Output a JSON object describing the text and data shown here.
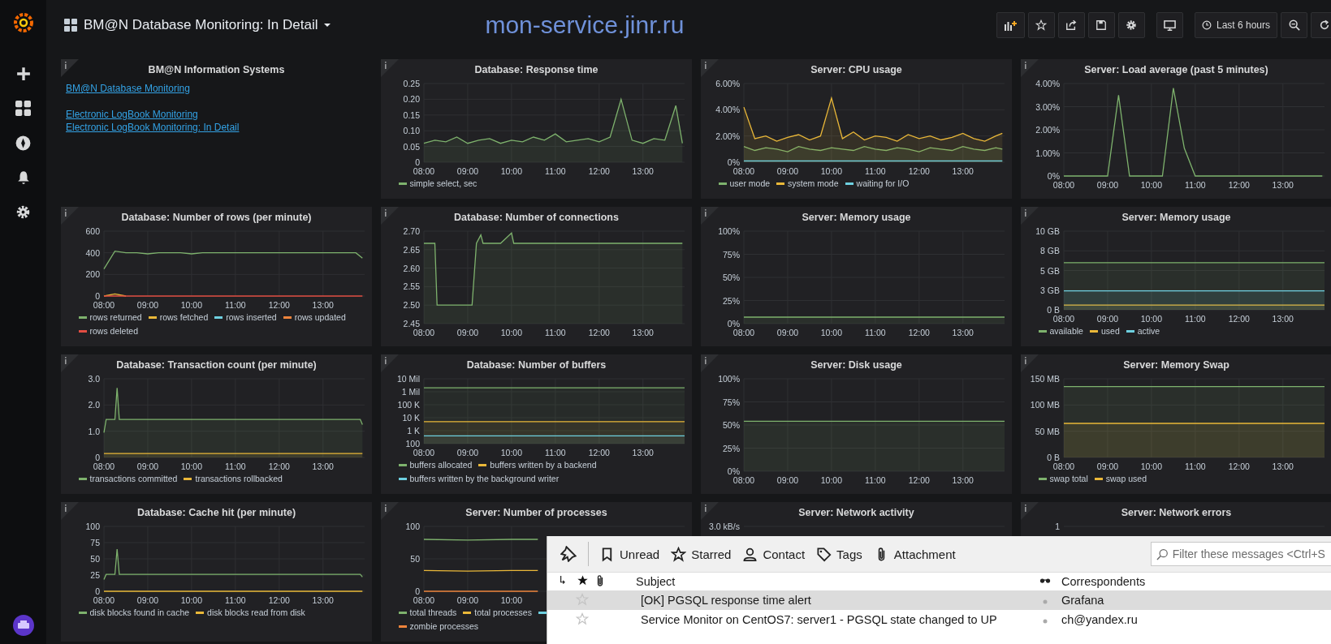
{
  "topbar": {
    "title": "BM@N Database Monitoring: In Detail",
    "site_text": "mon-service.jinr.ru",
    "time_range": "Last 6 hours"
  },
  "panels": [
    {
      "kind": "text",
      "title": "BM@N Information Systems",
      "link_groups": [
        [
          "BM@N Database Monitoring"
        ],
        [
          "Electronic LogBook Monitoring",
          "Electronic LogBook Monitoring: In Detail"
        ]
      ]
    },
    {
      "kind": "graph",
      "title": "Database: Response time",
      "chart_data": {
        "type": "area",
        "grid": true,
        "xlim": [
          8,
          13.95
        ],
        "ylim": [
          0,
          0.25
        ],
        "xticks": [
          {
            "value": 8,
            "label": "08:00"
          },
          {
            "value": 9,
            "label": "09:00"
          },
          {
            "value": 10,
            "label": "10:00"
          },
          {
            "value": 11,
            "label": "11:00"
          },
          {
            "value": 12,
            "label": "12:00"
          },
          {
            "value": 13,
            "label": "13:00"
          }
        ],
        "yticks": [
          {
            "value": 0,
            "label": "0"
          },
          {
            "value": 0.05,
            "label": "0.05"
          },
          {
            "value": 0.1,
            "label": "0.10"
          },
          {
            "value": 0.15,
            "label": "0.15"
          },
          {
            "value": 0.2,
            "label": "0.20"
          },
          {
            "value": 0.25,
            "label": "0.25"
          }
        ],
        "x": [
          8,
          8.25,
          8.5,
          8.75,
          9,
          9.25,
          9.5,
          9.75,
          10,
          10.25,
          10.5,
          10.75,
          11,
          11.25,
          11.5,
          11.75,
          12,
          12.25,
          12.5,
          12.75,
          13,
          13.25,
          13.5,
          13.75,
          13.9
        ],
        "series": [
          {
            "name": "simple select, sec",
            "color": "#7eb26d",
            "values": [
              0.06,
              0.07,
              0.065,
              0.08,
              0.06,
              0.07,
              0.075,
              0.06,
              0.07,
              0.065,
              0.08,
              0.07,
              0.09,
              0.065,
              0.07,
              0.075,
              0.065,
              0.08,
              0.2,
              0.07,
              0.06,
              0.075,
              0.07,
              0.18,
              0.06
            ]
          }
        ]
      }
    },
    {
      "kind": "graph",
      "title": "Server: CPU usage",
      "chart_data": {
        "type": "area",
        "grid": true,
        "xlim": [
          8,
          13.95
        ],
        "ylim": [
          0,
          6
        ],
        "xticks": [
          {
            "value": 8,
            "label": "08:00"
          },
          {
            "value": 9,
            "label": "09:00"
          },
          {
            "value": 10,
            "label": "10:00"
          },
          {
            "value": 11,
            "label": "11:00"
          },
          {
            "value": 12,
            "label": "12:00"
          },
          {
            "value": 13,
            "label": "13:00"
          }
        ],
        "yticks": [
          {
            "value": 0,
            "label": "0%"
          },
          {
            "value": 2,
            "label": "2.00%"
          },
          {
            "value": 4,
            "label": "4.00%"
          },
          {
            "value": 6,
            "label": "6.00%"
          }
        ],
        "x": [
          8,
          8.25,
          8.5,
          8.75,
          9,
          9.25,
          9.5,
          9.75,
          10,
          10.25,
          10.5,
          10.75,
          11,
          11.25,
          11.5,
          11.75,
          12,
          12.25,
          12.5,
          12.75,
          13,
          13.25,
          13.5,
          13.75,
          13.9
        ],
        "series": [
          {
            "name": "user mode",
            "color": "#7eb26d",
            "values": [
              1.2,
              0.9,
              1.1,
              1.0,
              0.8,
              1.2,
              1.0,
              0.9,
              1.1,
              1.0,
              0.9,
              1.2,
              1.0,
              0.9,
              1.1,
              1.0,
              0.8,
              1.1,
              1.0,
              0.9,
              1.2,
              1.0,
              0.9,
              1.1,
              1.0
            ]
          },
          {
            "name": "system mode",
            "color": "#eab839",
            "values": [
              4.2,
              1.8,
              2.0,
              1.6,
              1.9,
              2.1,
              1.7,
              2.0,
              4.9,
              1.8,
              2.3,
              1.7,
              2.0,
              1.9,
              1.6,
              2.1,
              1.8,
              2.0,
              1.7,
              1.9,
              2.2,
              1.8,
              1.6,
              2.0,
              2.2
            ]
          },
          {
            "name": "waiting for I/O",
            "color": "#6ed0e0",
            "values": [
              0.1,
              0.1,
              0.1,
              0.1,
              0.1,
              0.1,
              0.1,
              0.1,
              0.1,
              0.1,
              0.1,
              0.1,
              0.1,
              0.1,
              0.1,
              0.1,
              0.1,
              0.1,
              0.1,
              0.1,
              0.1,
              0.1,
              0.1,
              0.1,
              0.1
            ]
          }
        ]
      }
    },
    {
      "kind": "graph",
      "title": "Server: Load average (past 5 minutes)",
      "chart_data": {
        "type": "line",
        "grid": true,
        "xlim": [
          8,
          13.95
        ],
        "ylim": [
          0,
          4
        ],
        "xticks": [
          {
            "value": 8,
            "label": "08:00"
          },
          {
            "value": 9,
            "label": "09:00"
          },
          {
            "value": 10,
            "label": "10:00"
          },
          {
            "value": 11,
            "label": "11:00"
          },
          {
            "value": 12,
            "label": "12:00"
          },
          {
            "value": 13,
            "label": "13:00"
          }
        ],
        "yticks": [
          {
            "value": 0,
            "label": "0%"
          },
          {
            "value": 1,
            "label": "1.00%"
          },
          {
            "value": 2,
            "label": "2.00%"
          },
          {
            "value": 3,
            "label": "3.00%"
          },
          {
            "value": 4,
            "label": "4.00%"
          }
        ],
        "x": [
          8,
          8.25,
          8.5,
          8.75,
          9,
          9.25,
          9.5,
          9.75,
          10,
          10.25,
          10.5,
          10.75,
          11,
          11.25,
          11.5,
          11.75,
          12,
          12.25,
          12.5,
          12.75,
          13,
          13.25,
          13.5,
          13.75,
          13.9
        ],
        "series": [
          {
            "color": "#7eb26d",
            "values": [
              0,
              0,
              0,
              0,
              0,
              3.5,
              0,
              0,
              0,
              0,
              3.8,
              1.2,
              0,
              0,
              0,
              0,
              0,
              0,
              0,
              0,
              0,
              0,
              0,
              0,
              0
            ]
          }
        ]
      }
    },
    {
      "kind": "graph",
      "title": "Database: Number of rows (per minute)",
      "chart_data": {
        "type": "line",
        "grid": true,
        "xlim": [
          8,
          13.95
        ],
        "ylim": [
          0,
          600
        ],
        "xticks": [
          {
            "value": 8,
            "label": "08:00"
          },
          {
            "value": 9,
            "label": "09:00"
          },
          {
            "value": 10,
            "label": "10:00"
          },
          {
            "value": 11,
            "label": "11:00"
          },
          {
            "value": 12,
            "label": "12:00"
          },
          {
            "value": 13,
            "label": "13:00"
          }
        ],
        "yticks": [
          0,
          200,
          400,
          600
        ],
        "x": [
          8,
          8.25,
          8.5,
          8.75,
          9,
          9.25,
          9.5,
          9.75,
          10,
          10.25,
          10.5,
          10.75,
          11,
          11.25,
          11.5,
          11.75,
          12,
          12.25,
          12.5,
          12.75,
          13,
          13.25,
          13.5,
          13.75,
          13.9
        ],
        "series": [
          {
            "name": "rows returned",
            "color": "#7eb26d",
            "values": [
              250,
              415,
              400,
              400,
              390,
              400,
              400,
              400,
              390,
              400,
              400,
              400,
              400,
              400,
              400,
              400,
              400,
              400,
              400,
              400,
              400,
              400,
              400,
              400,
              350
            ]
          },
          {
            "name": "rows fetched",
            "color": "#eab839",
            "values": [
              0,
              20,
              0,
              null,
              null,
              null,
              null,
              null,
              null,
              null,
              null,
              null,
              null,
              null,
              null,
              null,
              null,
              null,
              null,
              null,
              null,
              null,
              null,
              null,
              null
            ]
          },
          {
            "name": "rows inserted",
            "color": "#6ed0e0",
            "values": [
              null,
              null,
              null,
              null,
              null,
              null,
              null,
              null,
              null,
              null,
              null,
              null,
              null,
              null,
              null,
              null,
              null,
              null,
              null,
              null,
              null,
              null,
              null,
              null,
              null
            ]
          },
          {
            "name": "rows updated",
            "color": "#ef843c",
            "values": [
              null,
              null,
              null,
              null,
              null,
              null,
              null,
              null,
              null,
              null,
              null,
              null,
              null,
              null,
              null,
              null,
              null,
              null,
              null,
              null,
              null,
              null,
              null,
              null,
              null
            ]
          },
          {
            "name": "rows deleted",
            "color": "#e24d42",
            "values": [
              0,
              0,
              0,
              0,
              0,
              0,
              0,
              0,
              0,
              0,
              0,
              0,
              0,
              0,
              0,
              0,
              0,
              0,
              0,
              0,
              0,
              0,
              0,
              0,
              0
            ]
          }
        ]
      }
    },
    {
      "kind": "graph",
      "title": "Database: Number of connections",
      "chart_data": {
        "type": "area",
        "grid": true,
        "xlim": [
          8,
          13.95
        ],
        "ylim": [
          2.45,
          2.7
        ],
        "xticks": [
          {
            "value": 8,
            "label": "08:00"
          },
          {
            "value": 9,
            "label": "09:00"
          },
          {
            "value": 10,
            "label": "10:00"
          },
          {
            "value": 11,
            "label": "11:00"
          },
          {
            "value": 12,
            "label": "12:00"
          },
          {
            "value": 13,
            "label": "13:00"
          }
        ],
        "yticks": [
          {
            "value": 2.45,
            "label": "2.45"
          },
          {
            "value": 2.5,
            "label": "2.50"
          },
          {
            "value": 2.55,
            "label": "2.55"
          },
          {
            "value": 2.6,
            "label": "2.60"
          },
          {
            "value": 2.65,
            "label": "2.65"
          },
          {
            "value": 2.7,
            "label": "2.70"
          }
        ],
        "x": [
          8,
          8.25,
          8.3,
          8.75,
          9,
          9.1,
          9.2,
          9.3,
          9.35,
          9.75,
          10,
          10.05,
          10.5,
          11,
          11.5,
          12,
          12.5,
          13,
          13.5,
          13.9
        ],
        "series": [
          {
            "color": "#7eb26d",
            "values": [
              2.667,
              2.667,
              2.5,
              2.5,
              2.5,
              2.5,
              2.667,
              2.69,
              2.667,
              2.667,
              2.695,
              2.667,
              2.667,
              2.667,
              2.667,
              2.667,
              2.667,
              2.667,
              2.667,
              2.667
            ]
          }
        ]
      }
    },
    {
      "kind": "graph",
      "title": "Server: Memory usage",
      "chart_data": {
        "type": "area",
        "grid": true,
        "xlim": [
          8,
          13.95
        ],
        "ylim": [
          0,
          100
        ],
        "xticks": [
          {
            "value": 8,
            "label": "08:00"
          },
          {
            "value": 9,
            "label": "09:00"
          },
          {
            "value": 10,
            "label": "10:00"
          },
          {
            "value": 11,
            "label": "11:00"
          },
          {
            "value": 12,
            "label": "12:00"
          },
          {
            "value": 13,
            "label": "13:00"
          }
        ],
        "yticks": [
          {
            "value": 0,
            "label": "0%"
          },
          {
            "value": 25,
            "label": "25%"
          },
          {
            "value": 50,
            "label": "50%"
          },
          {
            "value": 75,
            "label": "75%"
          },
          {
            "value": 100,
            "label": "100%"
          }
        ],
        "x": [
          8,
          13.95
        ],
        "series": [
          {
            "color": "#7eb26d",
            "values": [
              7,
              7
            ]
          }
        ]
      }
    },
    {
      "kind": "graph",
      "title": "Server: Memory usage",
      "chart_data": {
        "type": "area",
        "grid": true,
        "xlim": [
          8,
          13.95
        ],
        "ylim": [
          0,
          10
        ],
        "xticks": [
          {
            "value": 8,
            "label": "08:00"
          },
          {
            "value": 9,
            "label": "09:00"
          },
          {
            "value": 10,
            "label": "10:00"
          },
          {
            "value": 11,
            "label": "11:00"
          },
          {
            "value": 12,
            "label": "12:00"
          },
          {
            "value": 13,
            "label": "13:00"
          }
        ],
        "yticks": [
          {
            "value": 0,
            "label": "0 B"
          },
          {
            "value": 2.5,
            "label": "3 GB"
          },
          {
            "value": 5,
            "label": "5 GB"
          },
          {
            "value": 7.5,
            "label": "8 GB"
          },
          {
            "value": 10,
            "label": "10 GB"
          }
        ],
        "x": [
          8,
          13.95
        ],
        "series": [
          {
            "name": "available",
            "color": "#7eb26d",
            "values": [
              6.0,
              6.0
            ]
          },
          {
            "name": "used",
            "color": "#eab839",
            "values": [
              0.6,
              0.6
            ]
          },
          {
            "name": "active",
            "color": "#6ed0e0",
            "values": [
              2.4,
              2.4
            ]
          }
        ]
      }
    },
    {
      "kind": "graph",
      "title": "Database: Transaction count (per minute)",
      "chart_data": {
        "type": "area",
        "grid": true,
        "xlim": [
          8,
          13.95
        ],
        "ylim": [
          0,
          3
        ],
        "xticks": [
          {
            "value": 8,
            "label": "08:00"
          },
          {
            "value": 9,
            "label": "09:00"
          },
          {
            "value": 10,
            "label": "10:00"
          },
          {
            "value": 11,
            "label": "11:00"
          },
          {
            "value": 12,
            "label": "12:00"
          },
          {
            "value": 13,
            "label": "13:00"
          }
        ],
        "yticks": [
          {
            "value": 0,
            "label": "0"
          },
          {
            "value": 1,
            "label": "1.0"
          },
          {
            "value": 2,
            "label": "2.0"
          },
          {
            "value": 3,
            "label": "3.0"
          }
        ],
        "x": [
          8,
          8.05,
          8.25,
          8.3,
          8.35,
          8.5,
          9,
          9.5,
          10,
          10.5,
          11,
          11.5,
          12,
          12.5,
          13,
          13.5,
          13.85,
          13.9
        ],
        "series": [
          {
            "name": "transactions committed",
            "color": "#7eb26d",
            "values": [
              0.95,
              1.45,
              1.45,
              2.65,
              1.45,
              1.45,
              1.45,
              1.45,
              1.45,
              1.45,
              1.45,
              1.45,
              1.45,
              1.45,
              1.45,
              1.45,
              1.45,
              1.25
            ]
          },
          {
            "name": "transactions rollbacked",
            "color": "#eab839",
            "values": [
              0.15,
              0.15,
              0.15,
              0.15,
              0.15,
              0.15,
              0.15,
              0.15,
              0.15,
              0.15,
              0.15,
              0.15,
              0.15,
              0.15,
              0.15,
              0.15,
              0.15,
              0.15
            ]
          }
        ]
      }
    },
    {
      "kind": "graph_picture",
      "title": "Database: Number of buffers",
      "y_labels": [
        "10 Mil",
        "1 Mil",
        "100 K",
        "10 K",
        "1 K",
        "100"
      ],
      "x_labels": [
        "08:00",
        "09:00",
        "10:00",
        "11:00",
        "12:00",
        "13:00"
      ],
      "legend": [
        {
          "name": "buffers allocated",
          "color": "#7eb26d"
        },
        {
          "name": "buffers written by a backend",
          "color": "#eab839"
        },
        {
          "name": "buffers written by the background writer",
          "color": "#6ed0e0"
        }
      ]
    },
    {
      "kind": "graph",
      "title": "Server: Disk usage",
      "chart_data": {
        "type": "area",
        "grid": true,
        "xlim": [
          8,
          13.95
        ],
        "ylim": [
          0,
          100
        ],
        "xticks": [
          {
            "value": 8,
            "label": "08:00"
          },
          {
            "value": 9,
            "label": "09:00"
          },
          {
            "value": 10,
            "label": "10:00"
          },
          {
            "value": 11,
            "label": "11:00"
          },
          {
            "value": 12,
            "label": "12:00"
          },
          {
            "value": 13,
            "label": "13:00"
          }
        ],
        "yticks": [
          {
            "value": 0,
            "label": "0%"
          },
          {
            "value": 25,
            "label": "25%"
          },
          {
            "value": 50,
            "label": "50%"
          },
          {
            "value": 75,
            "label": "75%"
          },
          {
            "value": 100,
            "label": "100%"
          }
        ],
        "x": [
          8,
          13.95
        ],
        "series": [
          {
            "color": "#7eb26d",
            "values": [
              54,
              54
            ]
          }
        ]
      }
    },
    {
      "kind": "graph",
      "title": "Server: Memory Swap",
      "chart_data": {
        "type": "area",
        "grid": true,
        "xlim": [
          8,
          13.95
        ],
        "ylim": [
          0,
          150
        ],
        "xticks": [
          {
            "value": 8,
            "label": "08:00"
          },
          {
            "value": 9,
            "label": "09:00"
          },
          {
            "value": 10,
            "label": "10:00"
          },
          {
            "value": 11,
            "label": "11:00"
          },
          {
            "value": 12,
            "label": "12:00"
          },
          {
            "value": 13,
            "label": "13:00"
          }
        ],
        "yticks": [
          {
            "value": 0,
            "label": "0 B"
          },
          {
            "value": 50,
            "label": "50 MB"
          },
          {
            "value": 100,
            "label": "100 MB"
          },
          {
            "value": 150,
            "label": "150 MB"
          }
        ],
        "x": [
          8,
          13.95
        ],
        "series": [
          {
            "name": "swap total",
            "color": "#7eb26d",
            "values": [
              135,
              135
            ]
          },
          {
            "name": "swap used",
            "color": "#eab839",
            "values": [
              65,
              65
            ]
          }
        ]
      }
    },
    {
      "kind": "graph",
      "title": "Database: Cache hit (per minute)",
      "chart_data": {
        "type": "line",
        "grid": true,
        "xlim": [
          8,
          13.95
        ],
        "ylim": [
          0,
          100
        ],
        "xticks": [
          {
            "value": 8,
            "label": "08:00"
          },
          {
            "value": 9,
            "label": "09:00"
          },
          {
            "value": 10,
            "label": "10:00"
          },
          {
            "value": 11,
            "label": "11:00"
          },
          {
            "value": 12,
            "label": "12:00"
          },
          {
            "value": 13,
            "label": "13:00"
          }
        ],
        "yticks": [
          0,
          25,
          50,
          75,
          100
        ],
        "x": [
          8,
          8.05,
          8.25,
          8.3,
          8.35,
          8.5,
          9,
          9.5,
          10,
          10.5,
          11,
          11.5,
          12,
          12.5,
          13,
          13.5,
          13.85,
          13.9
        ],
        "series": [
          {
            "name": "disk blocks found in cache",
            "color": "#7eb26d",
            "values": [
              18,
              26,
              26,
              65,
              26,
              26,
              26,
              26,
              26,
              26,
              26,
              26,
              26,
              26,
              26,
              26,
              26,
              22
            ]
          },
          {
            "name": "disk blocks read from disk",
            "color": "#eab839",
            "values": [
              0,
              0,
              0,
              0,
              0,
              0,
              0,
              0,
              0,
              0,
              0,
              0,
              0,
              0,
              0,
              0,
              0,
              0
            ]
          }
        ]
      }
    },
    {
      "kind": "graph",
      "title": "Server: Number of processes",
      "chart_data": {
        "type": "line",
        "grid": true,
        "xlim": [
          8,
          13.95
        ],
        "ylim": [
          0,
          100
        ],
        "xticks": [
          {
            "value": 8,
            "label": "08:00"
          },
          {
            "value": 9,
            "label": "09:00"
          },
          {
            "value": 10,
            "label": "10:00"
          }
        ],
        "yticks": [
          0,
          50,
          100
        ],
        "x": [
          8,
          9,
          10,
          10.6
        ],
        "series": [
          {
            "name": "total threads",
            "color": "#7eb26d",
            "values": [
              80,
              79,
              80,
              80
            ]
          },
          {
            "name": "total processes",
            "color": "#eab839",
            "values": [
              32,
              31,
              32,
              32
            ]
          },
          {
            "color": "#6ed0e0",
            "values": [
              null,
              null,
              null,
              null
            ]
          },
          {
            "name": "zombie processes",
            "color": "#ef843c",
            "values": [
              0,
              0,
              0,
              0
            ]
          }
        ]
      }
    },
    {
      "kind": "graph_picture",
      "title": "Server: Network activity",
      "y_labels": [
        "3.0 kB/s"
      ]
    },
    {
      "kind": "graph_picture",
      "title": "Server: Network errors",
      "y_labels": [
        "1"
      ]
    }
  ],
  "mail": {
    "toolbar": [
      {
        "kind": "unread",
        "label": "Unread"
      },
      {
        "kind": "starred",
        "label": "Starred"
      },
      {
        "kind": "contact",
        "label": "Contact"
      },
      {
        "kind": "tags",
        "label": "Tags"
      },
      {
        "kind": "attachment",
        "label": "Attachment"
      }
    ],
    "filter": {
      "placeholder": "Filter these messages <Ctrl+S"
    },
    "columns": {
      "subject": "Subject",
      "correspondents": "Correspondents"
    },
    "rows": [
      {
        "subject": "[OK] PGSQL response time alert",
        "correspondent": "Grafana",
        "selected": true,
        "starred": false
      },
      {
        "subject": "Service Monitor on CentOS7: server1 - PGSQL state changed to UP",
        "correspondent": "ch@yandex.ru",
        "selected": false,
        "starred": false
      }
    ]
  }
}
